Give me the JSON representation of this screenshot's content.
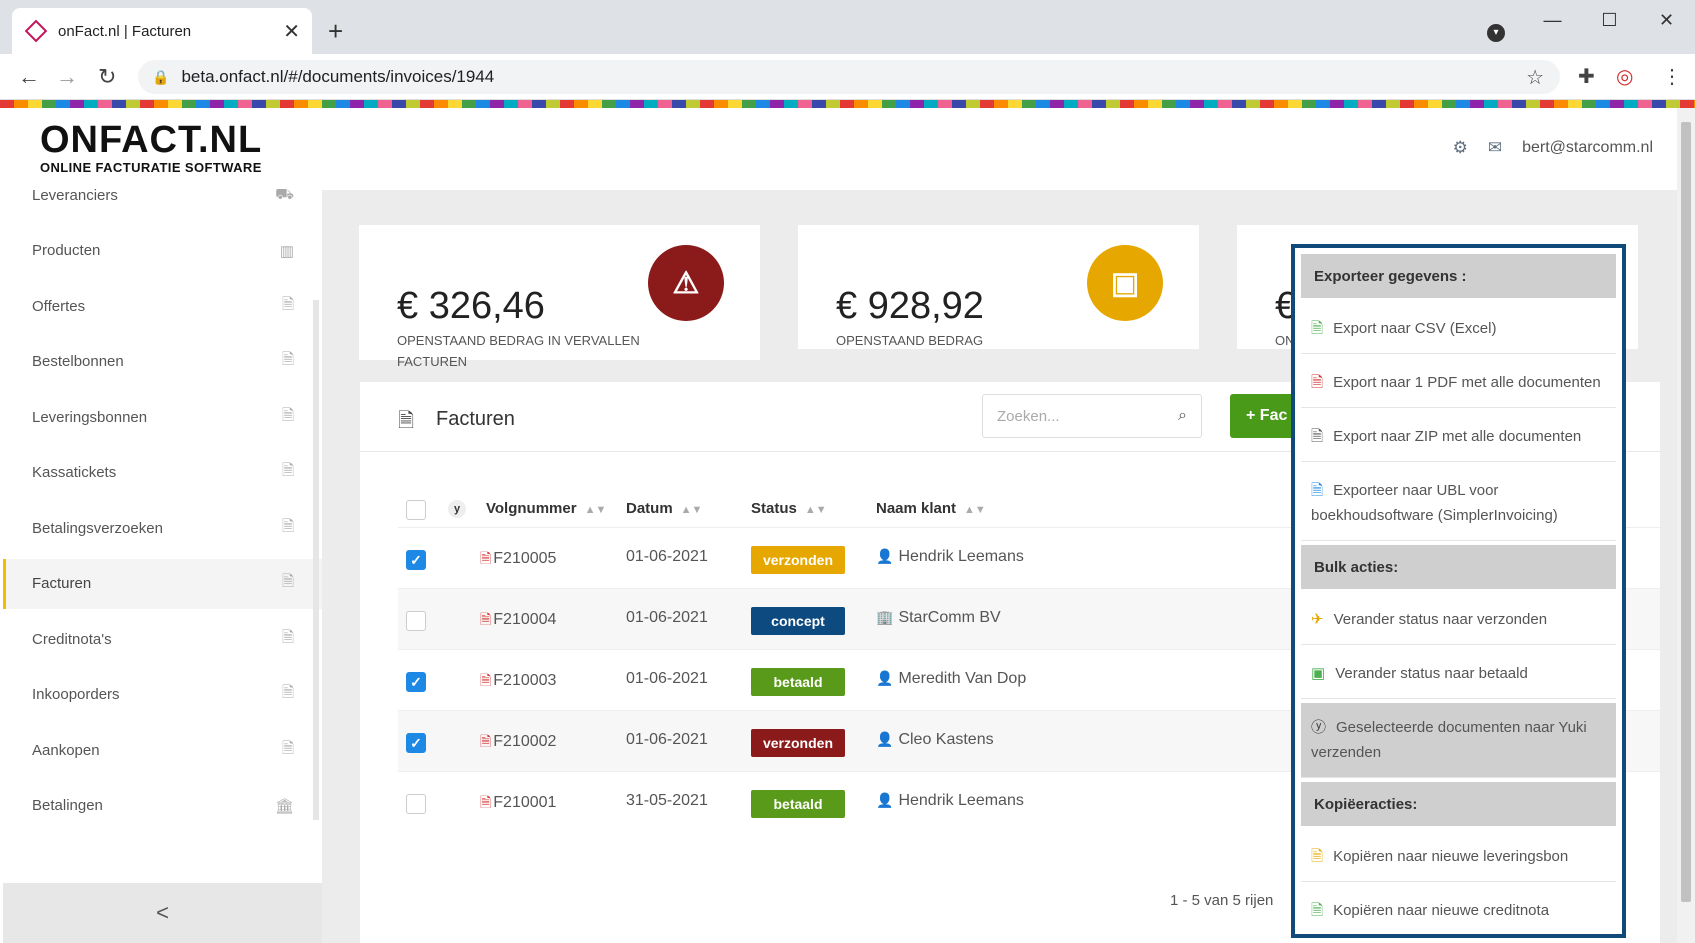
{
  "browser": {
    "tab_title": "onFact.nl | Facturen",
    "url": "beta.onfact.nl/#/documents/invoices/1944"
  },
  "logo": {
    "line1": "ONFACT.NL",
    "line2": "ONLINE FACTURATIE SOFTWARE"
  },
  "user": {
    "email": "bert@starcomm.nl"
  },
  "sidebar": {
    "items": [
      {
        "label": "Leveranciers",
        "icon": "truck-icon"
      },
      {
        "label": "Producten",
        "icon": "barcode-icon"
      },
      {
        "label": "Offertes",
        "icon": "pdf-file-icon"
      },
      {
        "label": "Bestelbonnen",
        "icon": "pdf-file-icon"
      },
      {
        "label": "Leveringsbonnen",
        "icon": "pdf-file-icon"
      },
      {
        "label": "Kassatickets",
        "icon": "pdf-file-icon"
      },
      {
        "label": "Betalingsverzoeken",
        "icon": "pdf-file-icon"
      },
      {
        "label": "Facturen",
        "icon": "pdf-file-icon",
        "active": true
      },
      {
        "label": "Creditnota's",
        "icon": "pdf-file-icon"
      },
      {
        "label": "Inkooporders",
        "icon": "pdf-file-icon"
      },
      {
        "label": "Aankopen",
        "icon": "pdf-file-icon"
      },
      {
        "label": "Betalingen",
        "icon": "bank-icon"
      }
    ],
    "collapse": "<"
  },
  "cards": [
    {
      "amount": "€ 326,46",
      "label": "OPENSTAAND BEDRAG IN VERVALLEN FACTUREN",
      "color": "#8b1a1a"
    },
    {
      "amount": "€ 928,92",
      "label": "OPENSTAAND BEDRAG",
      "color": "#e6a800"
    },
    {
      "amount": "€",
      "label": "ON"
    }
  ],
  "panel": {
    "title": "Facturen",
    "search_placeholder": "Zoeken...",
    "new_button": "+ Fac"
  },
  "table": {
    "headers": {
      "yuki": "y",
      "number": "Volgnummer",
      "date": "Datum",
      "status": "Status",
      "customer": "Naam klant"
    },
    "rows": [
      {
        "checked": true,
        "number": "F210005",
        "date": "01-06-2021",
        "status": "verzonden",
        "status_color": "#e6a800",
        "customer": "Hendrik Leemans",
        "customer_icon": "person-icon"
      },
      {
        "checked": false,
        "number": "F210004",
        "date": "01-06-2021",
        "status": "concept",
        "status_color": "#0d4a80",
        "customer": "StarComm BV",
        "customer_icon": "building-icon"
      },
      {
        "checked": true,
        "number": "F210003",
        "date": "01-06-2021",
        "status": "betaald",
        "status_color": "#5a9a1a",
        "customer": "Meredith Van Dop",
        "customer_icon": "person-icon"
      },
      {
        "checked": true,
        "number": "F210002",
        "date": "01-06-2021",
        "status": "verzonden",
        "status_color": "#8b1a1a",
        "customer": "Cleo Kastens",
        "customer_icon": "person-icon"
      },
      {
        "checked": false,
        "number": "F210001",
        "date": "31-05-2021",
        "status": "betaald",
        "status_color": "#5a9a1a",
        "customer": "Hendrik Leemans",
        "customer_icon": "person-icon"
      }
    ],
    "pager": "1 - 5 van 5 rijen"
  },
  "dropdown": {
    "h_export": "Exporteer gegevens :",
    "export": [
      {
        "label": "Export naar CSV (Excel)",
        "icon": "excel-file-icon",
        "color": "#4caf50"
      },
      {
        "label": "Export naar 1 PDF met alle documenten",
        "icon": "pdf-file-icon",
        "color": "#d32f2f"
      },
      {
        "label": "Export naar ZIP met alle documenten",
        "icon": "zip-file-icon",
        "color": "#555"
      },
      {
        "label": "Exporteer naar UBL voor boekhoudsoftware (SimplerInvoicing)",
        "icon": "code-file-icon",
        "color": "#1e88e5"
      }
    ],
    "h_bulk": "Bulk acties:",
    "bulk": [
      {
        "label": "Verander status naar verzonden",
        "icon": "paper-plane-icon",
        "color": "#e6a800"
      },
      {
        "label": "Verander status naar betaald",
        "icon": "money-icon",
        "color": "#4caf50"
      },
      {
        "label": "Geselecteerde documenten naar Yuki verzenden",
        "icon": "yuki-icon",
        "color": "#333",
        "highlighted": true
      }
    ],
    "h_copy": "Kopiëeracties:",
    "copy": [
      {
        "label": "Kopiëren naar nieuwe leveringsbon",
        "icon": "pdf-file-icon",
        "color": "#e6a800"
      },
      {
        "label": "Kopiëren naar nieuwe creditnota",
        "icon": "pdf-file-icon",
        "color": "#4caf50"
      }
    ]
  }
}
